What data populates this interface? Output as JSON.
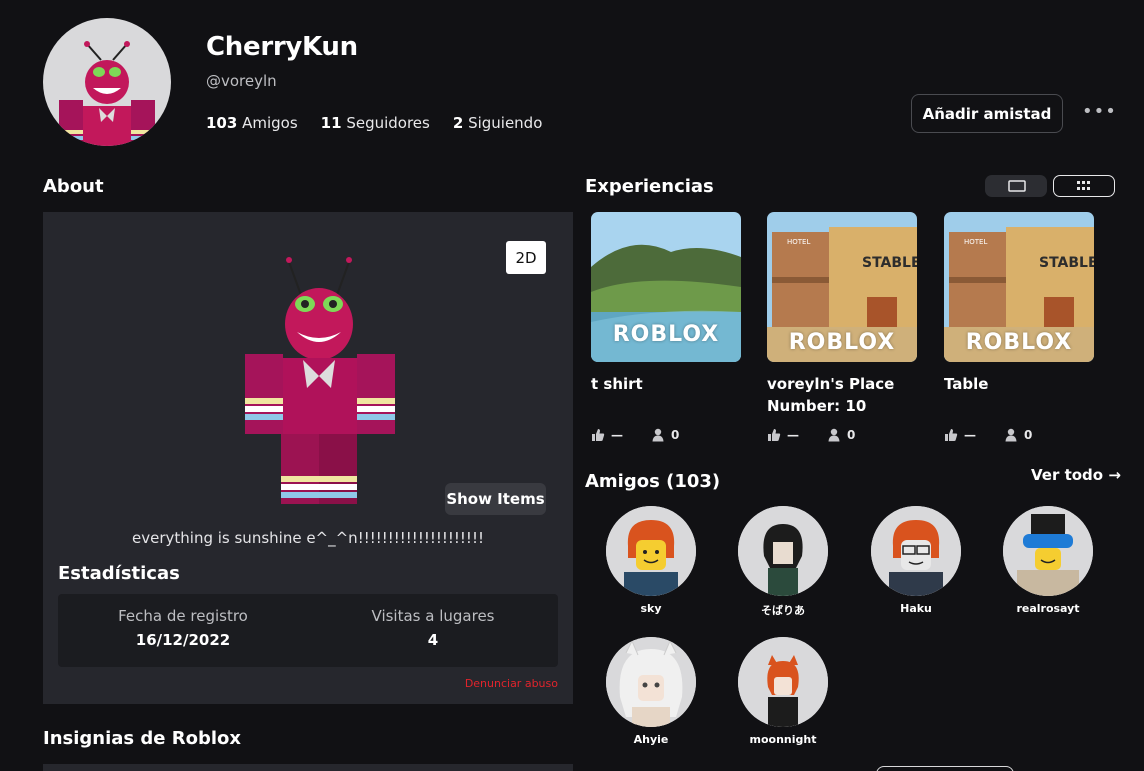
{
  "profile": {
    "display_name": "CherryKun",
    "handle": "@voreyln",
    "stats": [
      {
        "count": "103",
        "label": "Amigos"
      },
      {
        "count": "11",
        "label": "Seguidores"
      },
      {
        "count": "2",
        "label": "Siguiendo"
      }
    ],
    "add_friend_label": "Añadir amistad",
    "more_label": "•••"
  },
  "about": {
    "title": "About",
    "toggle_2d_label": "2D",
    "show_items_label": "Show Items",
    "bio": "everything is sunshine e^_^n!!!!!!!!!!!!!!!!!!!!!",
    "stats_title": "Estadísticas",
    "stats": [
      {
        "label": "Fecha de registro",
        "value": "16/12/2022"
      },
      {
        "label": "Visitas a lugares",
        "value": "4"
      }
    ],
    "report_label": "Denunciar abuso"
  },
  "badges": {
    "title": "Insignias de Roblox"
  },
  "experiences": {
    "title": "Experiencias",
    "items": [
      {
        "name": "t shirt",
        "likes": "—",
        "players": "0",
        "thumb_text": "ROBLOX"
      },
      {
        "name": "voreyln's Place Number: 10",
        "likes": "—",
        "players": "0",
        "thumb_text": "ROBLOX"
      },
      {
        "name": "Table",
        "likes": "—",
        "players": "0",
        "thumb_text": "ROBLOX"
      }
    ]
  },
  "friends": {
    "title": "Amigos (103)",
    "see_all_label": "Ver todo →",
    "items": [
      {
        "name": "sky"
      },
      {
        "name": "そばりあ"
      },
      {
        "name": "Haku"
      },
      {
        "name": "realrosayt"
      },
      {
        "name": "Ahyie"
      },
      {
        "name": "moonnight"
      }
    ]
  },
  "icons": [
    "more-icon",
    "thumbs-up-icon",
    "player-icon",
    "arrow-right-icon",
    "list-view-icon",
    "grid-view-icon"
  ],
  "colors": {
    "background": "#111114",
    "panel": "#26272d",
    "report": "#e0242c",
    "accent_avatar": "#c2185b"
  }
}
